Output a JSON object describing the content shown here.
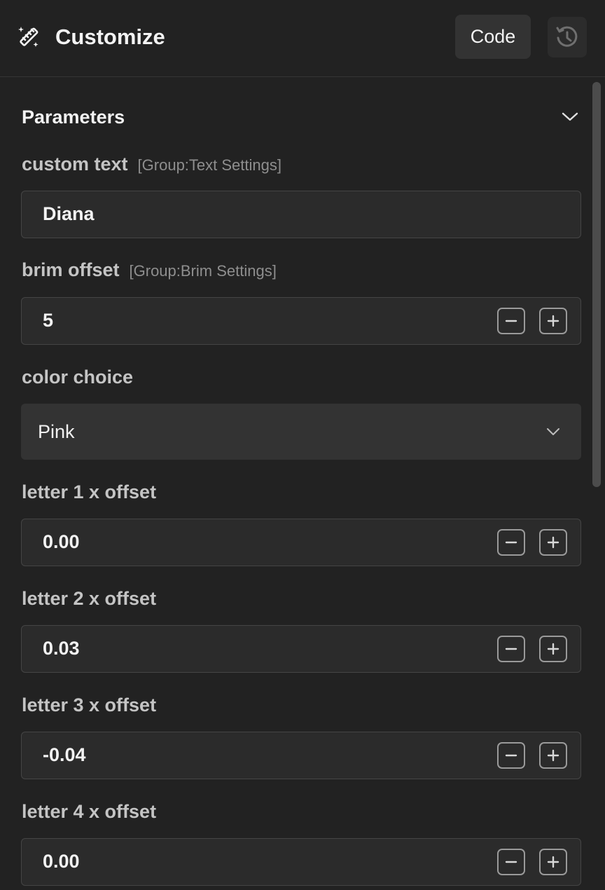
{
  "header": {
    "title": "Customize",
    "icon": "magic-wand-ruler-icon",
    "code_label": "Code",
    "history_icon": "history-icon"
  },
  "parameters": {
    "title": "Parameters",
    "fields": [
      {
        "label": "custom text",
        "group": "[Group:Text Settings]",
        "type": "text",
        "value": "Diana"
      },
      {
        "label": "brim offset",
        "group": "[Group:Brim Settings]",
        "type": "number",
        "value": "5"
      },
      {
        "label": "color choice",
        "group": "",
        "type": "select",
        "value": "Pink"
      },
      {
        "label": "letter 1 x offset",
        "group": "",
        "type": "number",
        "value": "0.00"
      },
      {
        "label": "letter 2 x offset",
        "group": "",
        "type": "number",
        "value": "0.03"
      },
      {
        "label": "letter 3 x offset",
        "group": "",
        "type": "number",
        "value": "-0.04"
      },
      {
        "label": "letter 4 x offset",
        "group": "",
        "type": "number",
        "value": "0.00"
      }
    ]
  },
  "colors": {
    "background": "#222222",
    "field_bg": "#2b2b2b",
    "field_border": "#454545",
    "select_bg": "#333333",
    "text": "#f3f3f3",
    "label": "#c4c4c4",
    "group_text": "#8e8e8e"
  }
}
